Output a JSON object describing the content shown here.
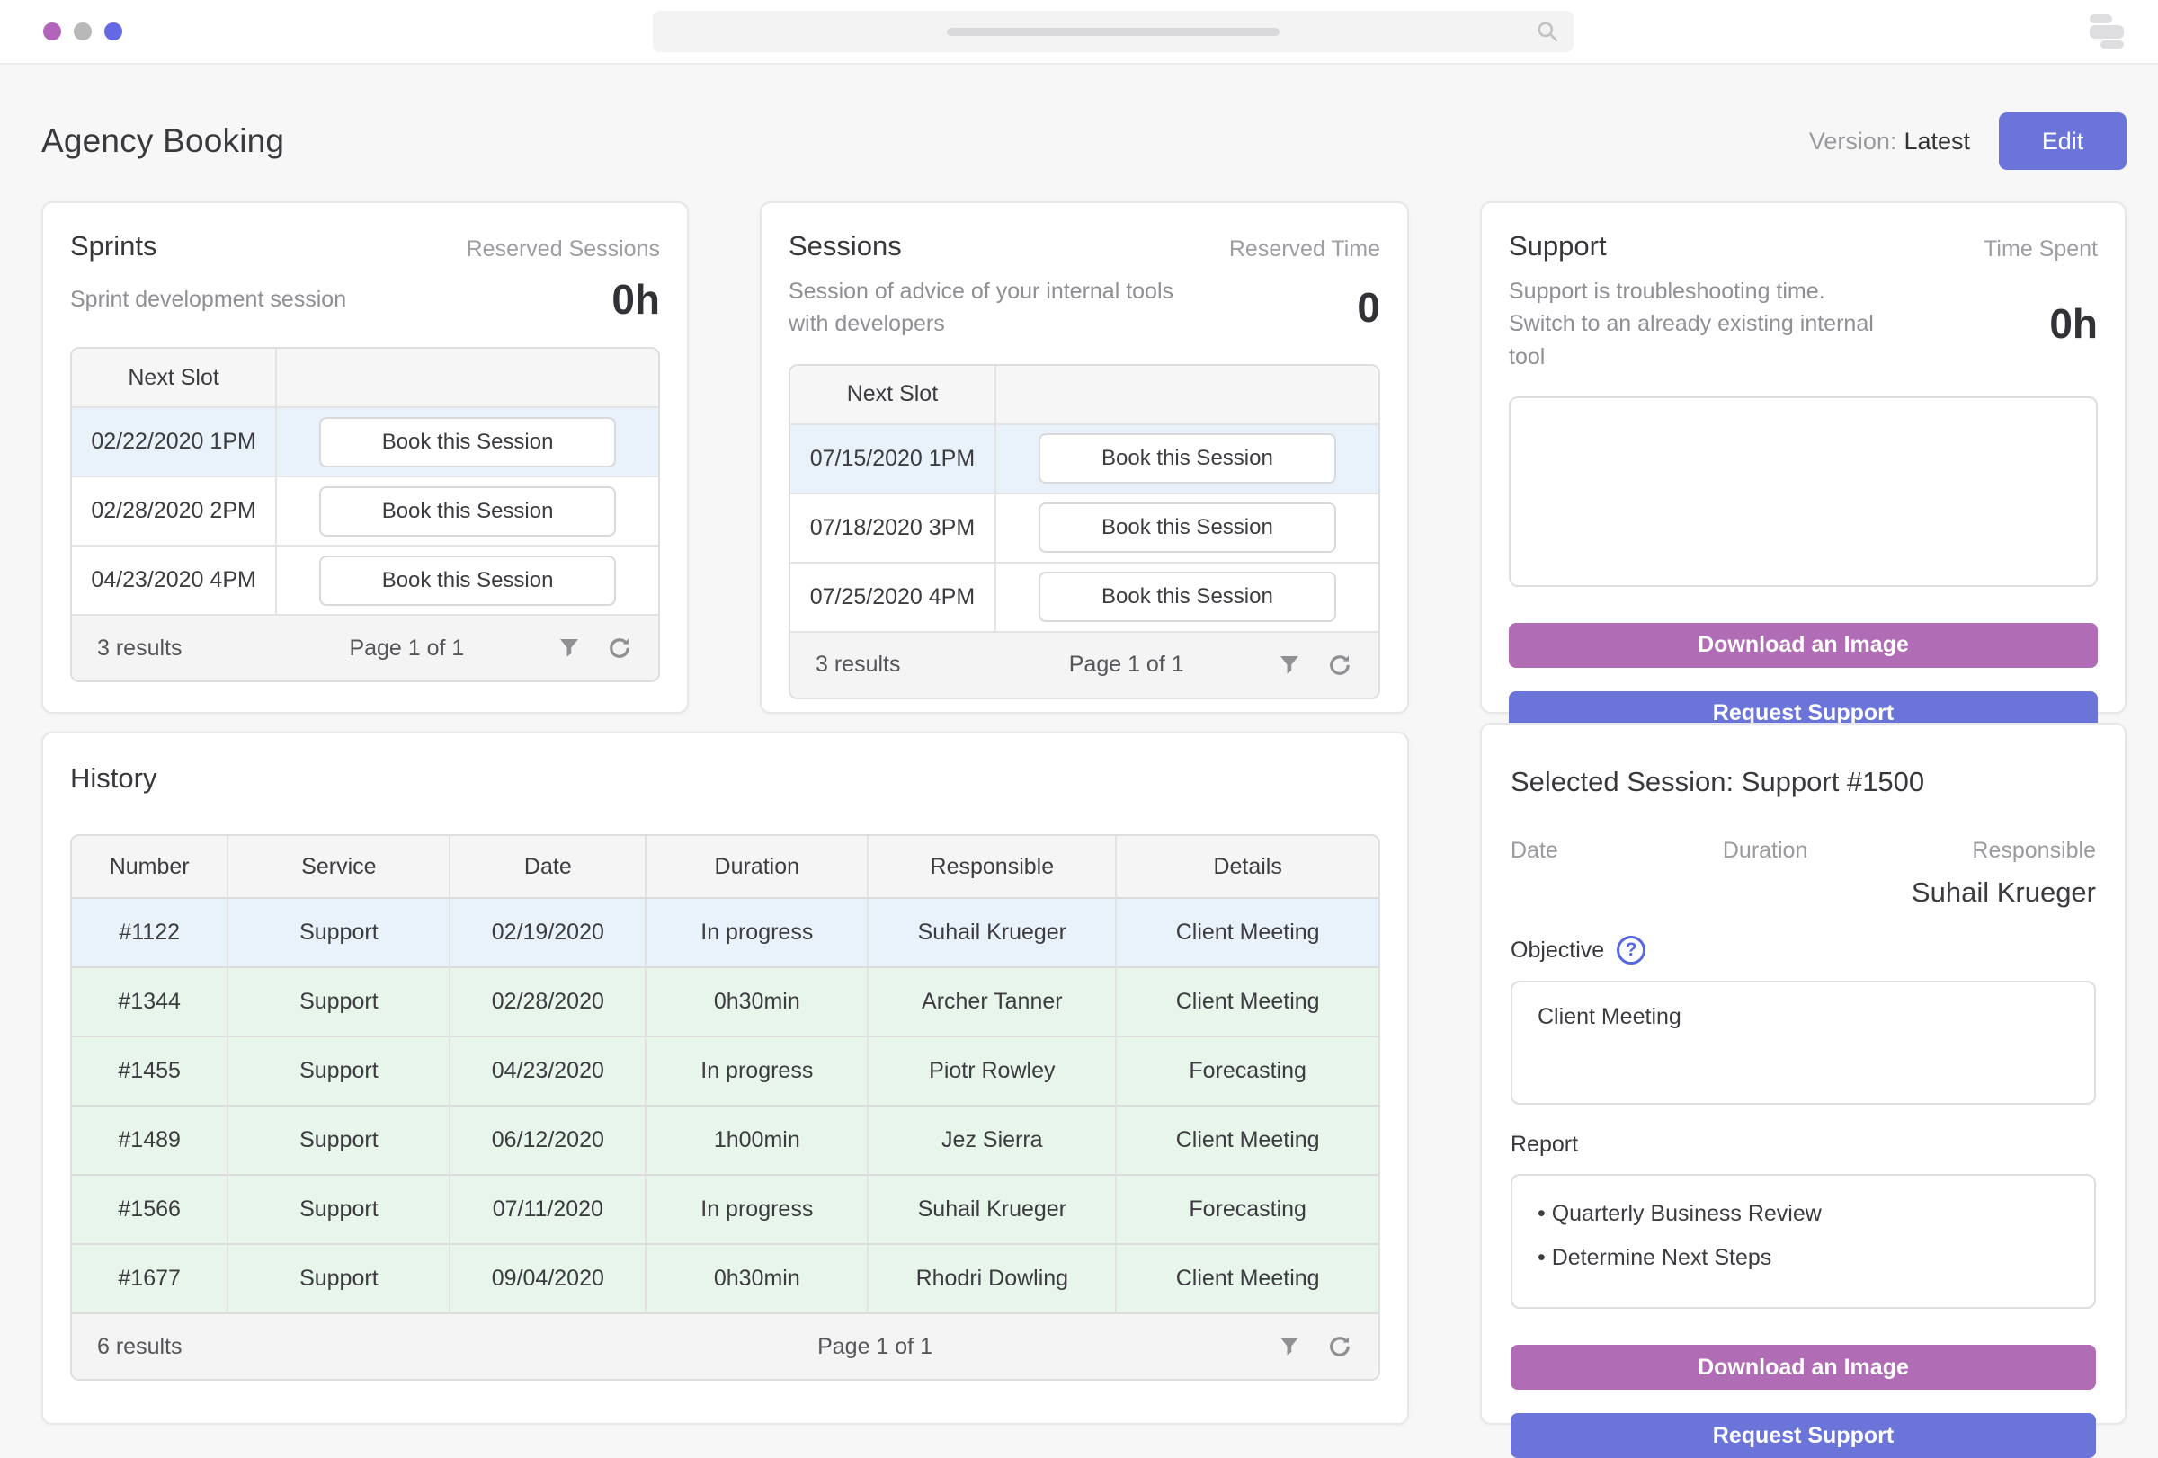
{
  "header": {
    "title": "Agency Booking",
    "version_label": "Version:",
    "version_value": "Latest",
    "edit_button": "Edit"
  },
  "cards": {
    "sprints": {
      "title": "Sprints",
      "subtitle": "Sprint development session",
      "metric_label": "Reserved Sessions",
      "metric_value": "0h",
      "table": {
        "header": "Next Slot",
        "button_label": "Book this Session",
        "rows": [
          "02/22/2020 1PM",
          "02/28/2020 2PM",
          "04/23/2020 4PM"
        ],
        "footer": {
          "results": "3 results",
          "page": "Page 1 of 1"
        }
      }
    },
    "sessions": {
      "title": "Sessions",
      "subtitle": "Session of advice of your internal tools with developers",
      "metric_label": "Reserved Time",
      "metric_value": "0",
      "table": {
        "header": "Next Slot",
        "button_label": "Book this Session",
        "rows": [
          "07/15/2020 1PM",
          "07/18/2020 3PM",
          "07/25/2020 4PM"
        ],
        "footer": {
          "results": "3 results",
          "page": "Page 1 of 1"
        }
      }
    },
    "support": {
      "title": "Support",
      "subtitle_line1": "Support is troubleshooting time.",
      "subtitle_line2": "Switch to an already existing internal tool",
      "metric_label": "Time Spent",
      "metric_value": "0h",
      "download_button": "Download an Image",
      "request_button": "Request Support"
    },
    "history": {
      "title": "History",
      "columns": [
        "Number",
        "Service",
        "Date",
        "Duration",
        "Responsible",
        "Details"
      ],
      "rows": [
        [
          "#1122",
          "Support",
          "02/19/2020",
          "In progress",
          "Suhail Krueger",
          "Client Meeting"
        ],
        [
          "#1344",
          "Support",
          "02/28/2020",
          "0h30min",
          "Archer Tanner",
          "Client Meeting"
        ],
        [
          "#1455",
          "Support",
          "04/23/2020",
          "In progress",
          "Piotr Rowley",
          "Forecasting"
        ],
        [
          "#1489",
          "Support",
          "06/12/2020",
          "1h00min",
          "Jez Sierra",
          "Client Meeting"
        ],
        [
          "#1566",
          "Support",
          "07/11/2020",
          "In progress",
          "Suhail Krueger",
          "Forecasting"
        ],
        [
          "#1677",
          "Support",
          "09/04/2020",
          "0h30min",
          "Rhodri Dowling",
          "Client Meeting"
        ]
      ],
      "footer": {
        "results": "6 results",
        "page": "Page 1 of 1"
      }
    },
    "selected": {
      "title": "Selected Session: Support #1500",
      "date_label": "Date",
      "duration_label": "Duration",
      "responsible_label": "Responsible",
      "responsible_value": "Suhail Krueger",
      "objective_label": "Objective",
      "help_icon": "?",
      "objective_value": "Client Meeting",
      "report_label": "Report",
      "report_items": [
        "Quarterly Business Review",
        "Determine Next Steps"
      ],
      "download_button": "Download an Image",
      "request_button": "Request Support"
    }
  },
  "colors": {
    "accent_indigo": "#6a74d9",
    "accent_purple": "#b06cb4",
    "row_blue": "#e9f1fb",
    "row_green": "#e8f5ea",
    "dot_purple": "#b263ba",
    "dot_gray": "#b8b8b8",
    "dot_indigo": "#6468e2",
    "help_blue": "#5667e0"
  }
}
